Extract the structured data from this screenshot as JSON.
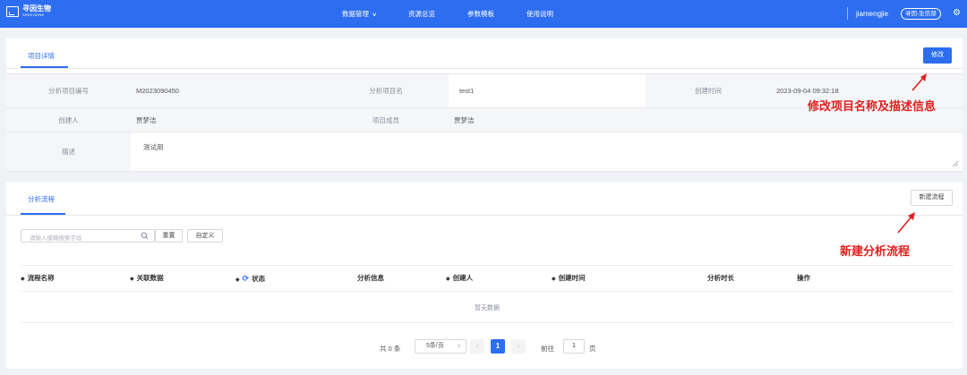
{
  "header": {
    "logo_cn": "寻因生物",
    "logo_en": "SEEKGENE",
    "nav": [
      {
        "label": "数据管理",
        "caret": "∨"
      },
      {
        "label": "资源总览"
      },
      {
        "label": "参数模板"
      },
      {
        "label": "使用说明"
      }
    ],
    "username": "jiamengjie",
    "org": "寻因-生信部",
    "settings_icon": "gear-icon"
  },
  "project": {
    "tab": "项目详情",
    "edit_button": "修改",
    "fields": {
      "id_label": "分析项目编号",
      "id_value": "M2023090450",
      "name_label": "分析项目名",
      "name_value": "test1",
      "created_label": "创建时间",
      "created_value": "2023-09-04 09:32:18",
      "creator_label": "创建人",
      "creator_value": "贾梦洁",
      "members_label": "项目成员",
      "members_value": "贾梦洁",
      "desc_label": "描述",
      "desc_value": "测试用"
    }
  },
  "annotations": {
    "edit_note": "修改项目名称及描述信息",
    "new_flow_note": "新建分析流程",
    "color": "#e02020"
  },
  "flows": {
    "tab": "分析流程",
    "new_button": "新建流程",
    "search_placeholder": "请输入模糊搜索字段",
    "reset_button": "重置",
    "custom_button": "自定义",
    "columns": [
      {
        "label": "流程名称",
        "sortable": true
      },
      {
        "label": "关联数据",
        "sortable": true
      },
      {
        "label": "状态",
        "sortable": true,
        "refresh": true
      },
      {
        "label": "分析信息"
      },
      {
        "label": "创建人",
        "sortable": true
      },
      {
        "label": "创建时间",
        "sortable": true
      },
      {
        "label": "分析时长"
      },
      {
        "label": "操作"
      }
    ],
    "empty_text": "暂无数据",
    "pagination": {
      "total": "共 0 条",
      "page_size": "5条/页",
      "current_page": "1",
      "prev": "‹",
      "next": "›",
      "goto_label": "前往",
      "goto_value": "1",
      "page_suffix": "页"
    }
  },
  "colors": {
    "primary": "#2d6ef0",
    "page_bg": "#f0f2f5"
  }
}
